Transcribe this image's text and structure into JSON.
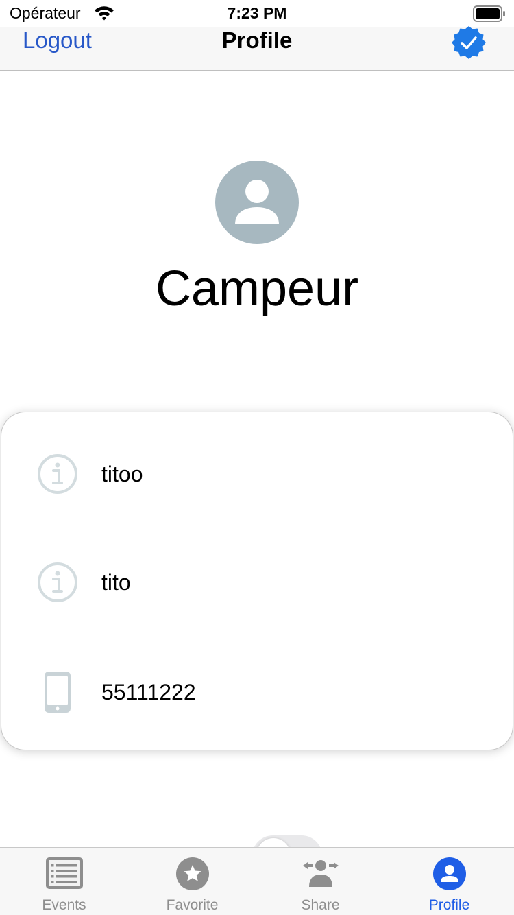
{
  "status_bar": {
    "carrier": "Opérateur",
    "time": "7:23 PM"
  },
  "nav": {
    "logout_label": "Logout",
    "title": "Profile",
    "right_icon": "verified-badge-icon",
    "accent_color": "#2858c8"
  },
  "profile": {
    "avatar_icon": "person-icon",
    "name": "Campeur"
  },
  "info": {
    "rows": [
      {
        "icon": "info-icon",
        "value": "titoo"
      },
      {
        "icon": "info-icon",
        "value": "tito"
      },
      {
        "icon": "phone-icon",
        "value": "55111222"
      }
    ]
  },
  "toggle": {
    "state": "off"
  },
  "tab_bar": {
    "active_color": "#1f5ee6",
    "tabs": [
      {
        "label": "Events",
        "icon": "list-icon",
        "active": false
      },
      {
        "label": "Favorite",
        "icon": "star-icon",
        "active": false
      },
      {
        "label": "Share",
        "icon": "share-person-icon",
        "active": false
      },
      {
        "label": "Profile",
        "icon": "profile-icon",
        "active": true
      }
    ]
  }
}
